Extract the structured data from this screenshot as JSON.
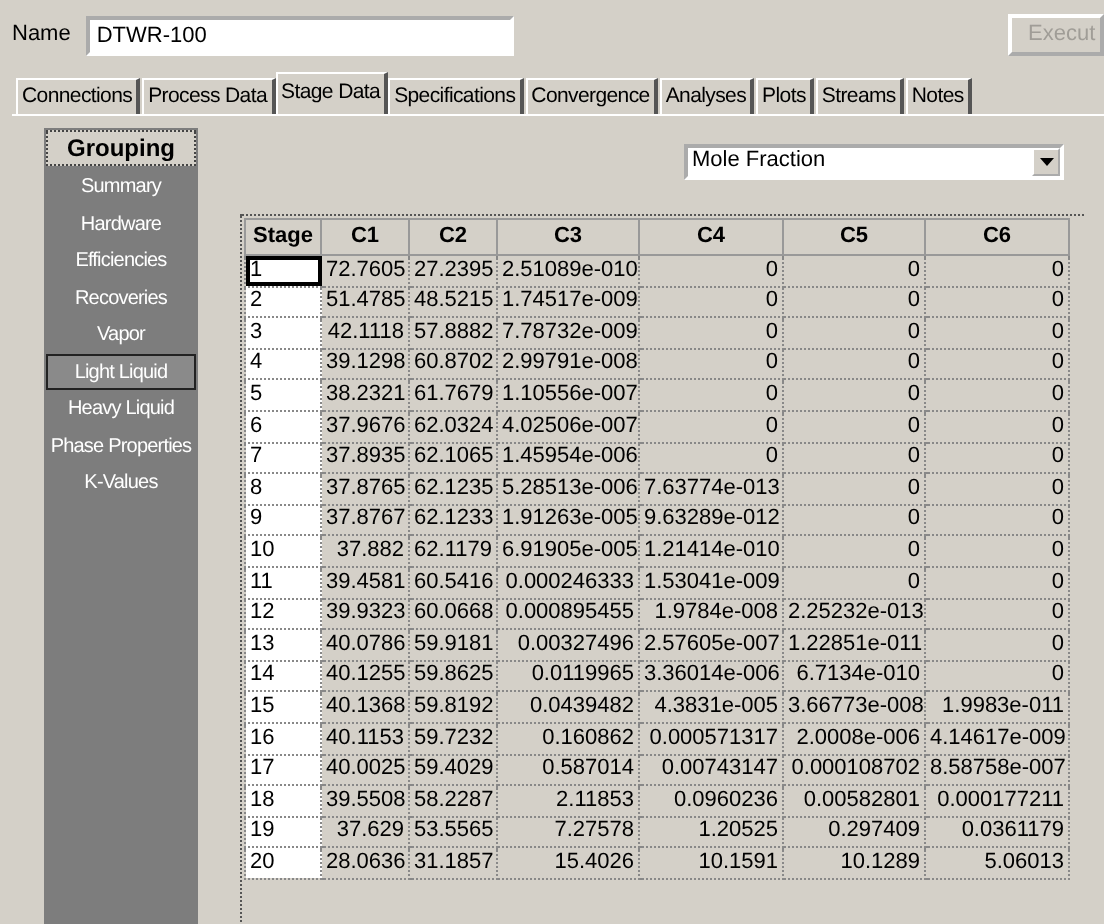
{
  "name_field": {
    "label": "Name",
    "value": "DTWR-100"
  },
  "execute_button": {
    "label": "Execut",
    "disabled": true
  },
  "tabs": [
    {
      "label": "Connections",
      "selected": false
    },
    {
      "label": "Process Data",
      "selected": false
    },
    {
      "label": "Stage Data",
      "selected": true
    },
    {
      "label": "Specifications",
      "selected": false
    },
    {
      "label": "Convergence",
      "selected": false
    },
    {
      "label": "Analyses",
      "selected": false
    },
    {
      "label": "Plots",
      "selected": false
    },
    {
      "label": "Streams",
      "selected": false
    },
    {
      "label": "Notes",
      "selected": false
    }
  ],
  "sidebar": {
    "header": "Grouping",
    "items": [
      {
        "label": "Summary",
        "selected": false
      },
      {
        "label": "Hardware",
        "selected": false
      },
      {
        "label": "Efficiencies",
        "selected": false
      },
      {
        "label": "Recoveries",
        "selected": false
      },
      {
        "label": "Vapor",
        "selected": false
      },
      {
        "label": "Light Liquid",
        "selected": true
      },
      {
        "label": "Heavy Liquid",
        "selected": false
      },
      {
        "label": "Phase Properties",
        "selected": false
      },
      {
        "label": "K-Values",
        "selected": false
      }
    ]
  },
  "basis_dropdown": {
    "value": "Mole Fraction"
  },
  "table": {
    "columns": [
      "Stage",
      "C1",
      "C2",
      "C3",
      "C4",
      "C5",
      "C6"
    ],
    "rows": [
      {
        "stage": "1",
        "selected": true,
        "values": [
          "72.7605",
          "27.2395",
          "2.51089e-010",
          "0",
          "0",
          "0"
        ]
      },
      {
        "stage": "2",
        "selected": false,
        "values": [
          "51.4785",
          "48.5215",
          "1.74517e-009",
          "0",
          "0",
          "0"
        ]
      },
      {
        "stage": "3",
        "selected": false,
        "values": [
          "42.1118",
          "57.8882",
          "7.78732e-009",
          "0",
          "0",
          "0"
        ]
      },
      {
        "stage": "4",
        "selected": false,
        "values": [
          "39.1298",
          "60.8702",
          "2.99791e-008",
          "0",
          "0",
          "0"
        ]
      },
      {
        "stage": "5",
        "selected": false,
        "values": [
          "38.2321",
          "61.7679",
          "1.10556e-007",
          "0",
          "0",
          "0"
        ]
      },
      {
        "stage": "6",
        "selected": false,
        "values": [
          "37.9676",
          "62.0324",
          "4.02506e-007",
          "0",
          "0",
          "0"
        ]
      },
      {
        "stage": "7",
        "selected": false,
        "values": [
          "37.8935",
          "62.1065",
          "1.45954e-006",
          "0",
          "0",
          "0"
        ]
      },
      {
        "stage": "8",
        "selected": false,
        "values": [
          "37.8765",
          "62.1235",
          "5.28513e-006",
          "7.63774e-013",
          "0",
          "0"
        ]
      },
      {
        "stage": "9",
        "selected": false,
        "values": [
          "37.8767",
          "62.1233",
          "1.91263e-005",
          "9.63289e-012",
          "0",
          "0"
        ]
      },
      {
        "stage": "10",
        "selected": false,
        "values": [
          "37.882",
          "62.1179",
          "6.91905e-005",
          "1.21414e-010",
          "0",
          "0"
        ]
      },
      {
        "stage": "11",
        "selected": false,
        "values": [
          "39.4581",
          "60.5416",
          "0.000246333",
          "1.53041e-009",
          "0",
          "0"
        ]
      },
      {
        "stage": "12",
        "selected": false,
        "values": [
          "39.9323",
          "60.0668",
          "0.000895455",
          "1.9784e-008",
          "2.25232e-013",
          "0"
        ]
      },
      {
        "stage": "13",
        "selected": false,
        "values": [
          "40.0786",
          "59.9181",
          "0.00327496",
          "2.57605e-007",
          "1.22851e-011",
          "0"
        ]
      },
      {
        "stage": "14",
        "selected": false,
        "values": [
          "40.1255",
          "59.8625",
          "0.0119965",
          "3.36014e-006",
          "6.7134e-010",
          "0"
        ]
      },
      {
        "stage": "15",
        "selected": false,
        "values": [
          "40.1368",
          "59.8192",
          "0.0439482",
          "4.3831e-005",
          "3.66773e-008",
          "1.9983e-011"
        ]
      },
      {
        "stage": "16",
        "selected": false,
        "values": [
          "40.1153",
          "59.7232",
          "0.160862",
          "0.000571317",
          "2.0008e-006",
          "4.14617e-009"
        ]
      },
      {
        "stage": "17",
        "selected": false,
        "values": [
          "40.0025",
          "59.4029",
          "0.587014",
          "0.00743147",
          "0.000108702",
          "8.58758e-007"
        ]
      },
      {
        "stage": "18",
        "selected": false,
        "values": [
          "39.5508",
          "58.2287",
          "2.11853",
          "0.0960236",
          "0.00582801",
          "0.000177211"
        ]
      },
      {
        "stage": "19",
        "selected": false,
        "values": [
          "37.629",
          "53.5565",
          "7.27578",
          "1.20525",
          "0.297409",
          "0.0361179"
        ]
      },
      {
        "stage": "20",
        "selected": false,
        "values": [
          "28.0636",
          "31.1857",
          "15.4026",
          "10.1591",
          "10.1289",
          "5.06013"
        ]
      }
    ]
  }
}
